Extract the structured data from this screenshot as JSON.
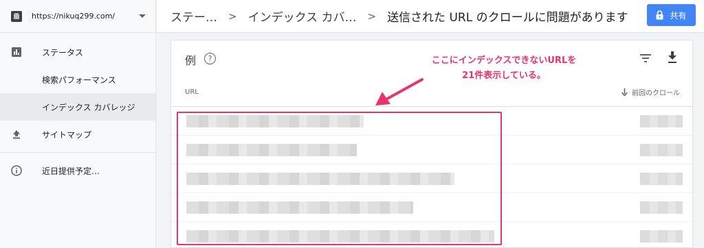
{
  "sidebar": {
    "property_url": "https://nikuq299.com/",
    "items": [
      {
        "label": "ステータス",
        "icon": "bar-chart-icon"
      },
      {
        "label": "検索パフォーマンス"
      },
      {
        "label": "インデックス カバレッジ"
      },
      {
        "label": "サイトマップ",
        "icon": "upload-icon"
      },
      {
        "label": "近日提供予定…",
        "icon": "info-icon"
      }
    ]
  },
  "header": {
    "breadcrumbs": [
      "ステー…",
      "インデックス カバ…",
      "送信された URL のクロールに問題があります"
    ],
    "share_label": "共有"
  },
  "card": {
    "title": "例",
    "help_glyph": "?",
    "columns": {
      "url": "URL",
      "last_crawl": "前回のクロール"
    }
  },
  "annotation": {
    "line1": "ここにインデックスできないURLを",
    "line2": "21件表示している。"
  },
  "colors": {
    "accent": "#4285f4",
    "annotation": "#e8336d"
  }
}
